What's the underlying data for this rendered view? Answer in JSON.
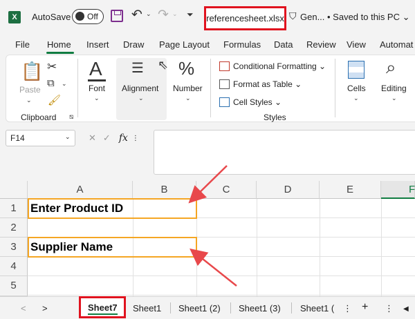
{
  "titlebar": {
    "logo": "X",
    "autosave_label": "AutoSave",
    "autosave_state": "Off",
    "filename": "referencesheet.xlsx",
    "sensitivity": "Gen...",
    "saved_status": "• Saved to this PC ⌄"
  },
  "tabs": [
    "File",
    "Home",
    "Insert",
    "Draw",
    "Page Layout",
    "Formulas",
    "Data",
    "Review",
    "View",
    "Automat"
  ],
  "active_tab": "Home",
  "ribbon": {
    "clipboard": {
      "paste": "Paste",
      "group": "Clipboard"
    },
    "font": {
      "label": "Font",
      "glyph": "A"
    },
    "alignment": {
      "label": "Alignment"
    },
    "number": {
      "label": "Number",
      "glyph": "%"
    },
    "styles": {
      "conditional": "Conditional Formatting ⌄",
      "table": "Format as Table ⌄",
      "cell": "Cell Styles ⌄",
      "group": "Styles"
    },
    "cells": {
      "label": "Cells"
    },
    "editing": {
      "label": "Editing"
    }
  },
  "formula_bar": {
    "name_box": "F14",
    "cancel": "✕",
    "enter": "✓",
    "fx": "fx",
    "content": ""
  },
  "grid": {
    "columns": [
      "A",
      "B",
      "C",
      "D",
      "E",
      "F"
    ],
    "rows": [
      "1",
      "2",
      "3",
      "4",
      "5"
    ],
    "cells": {
      "A1": "Enter Product ID",
      "A3": "Supplier Name"
    }
  },
  "sheets": {
    "nav_prev": "<",
    "nav_next": ">",
    "active": "Sheet7",
    "others": [
      "Sheet1",
      "Sheet1 (2)",
      "Sheet1 (3)",
      "Sheet1 ("
    ],
    "add": "+",
    "more": "⋮",
    "scroll_left": "◀"
  },
  "colors": {
    "excel_green": "#107c41",
    "highlight_red": "#e0121e",
    "highlight_orange": "#f5a623",
    "arrow": "#e8484b"
  }
}
